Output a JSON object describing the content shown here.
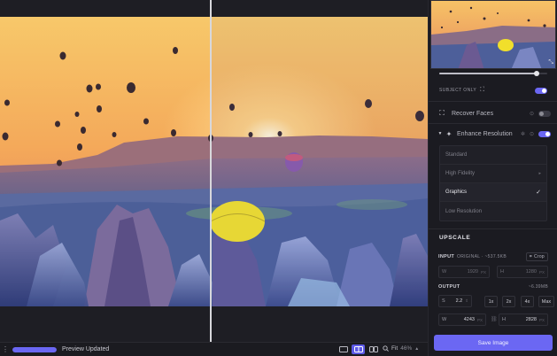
{
  "statusbar": {
    "menu_icon": "more-vertical-icon",
    "progress_fraction": 1.0,
    "status_text": "Preview Updated",
    "zoom_label": "Fit",
    "zoom_percent": "46%"
  },
  "panel": {
    "subject_only_label": "SUBJECT ONLY",
    "subject_slider_fraction": 0.9,
    "recover_faces": {
      "label": "Recover Faces",
      "enabled": false
    },
    "enhance_resolution": {
      "label": "Enhance Resolution",
      "enabled": true
    },
    "models": [
      {
        "label": "Standard",
        "selected": false
      },
      {
        "label": "High Fidelity",
        "selected": false
      },
      {
        "label": "Graphics",
        "selected": true
      },
      {
        "label": "Low Resolution",
        "selected": false
      }
    ],
    "upscale": {
      "title": "UPSCALE",
      "input_label": "INPUT",
      "input_meta": "ORIGINAL · ~537.5KB",
      "crop_label": "Crop",
      "input_w_key": "W",
      "input_w": "1920",
      "input_h_key": "H",
      "input_h": "1280",
      "unit": "PX",
      "output_label": "OUTPUT",
      "output_meta": "~6.39MB",
      "scale_key": "S",
      "scale_value": "2.2",
      "multipliers": [
        "1x",
        "2x",
        "4x",
        "Max"
      ],
      "output_w_key": "W",
      "output_w": "4243",
      "output_h_key": "H",
      "output_h": "2828"
    },
    "save_label": "Save Image"
  },
  "colors": {
    "accent": "#6b67f3",
    "panel_bg": "#1b1b21",
    "canvas_bg": "#1e1e24"
  }
}
